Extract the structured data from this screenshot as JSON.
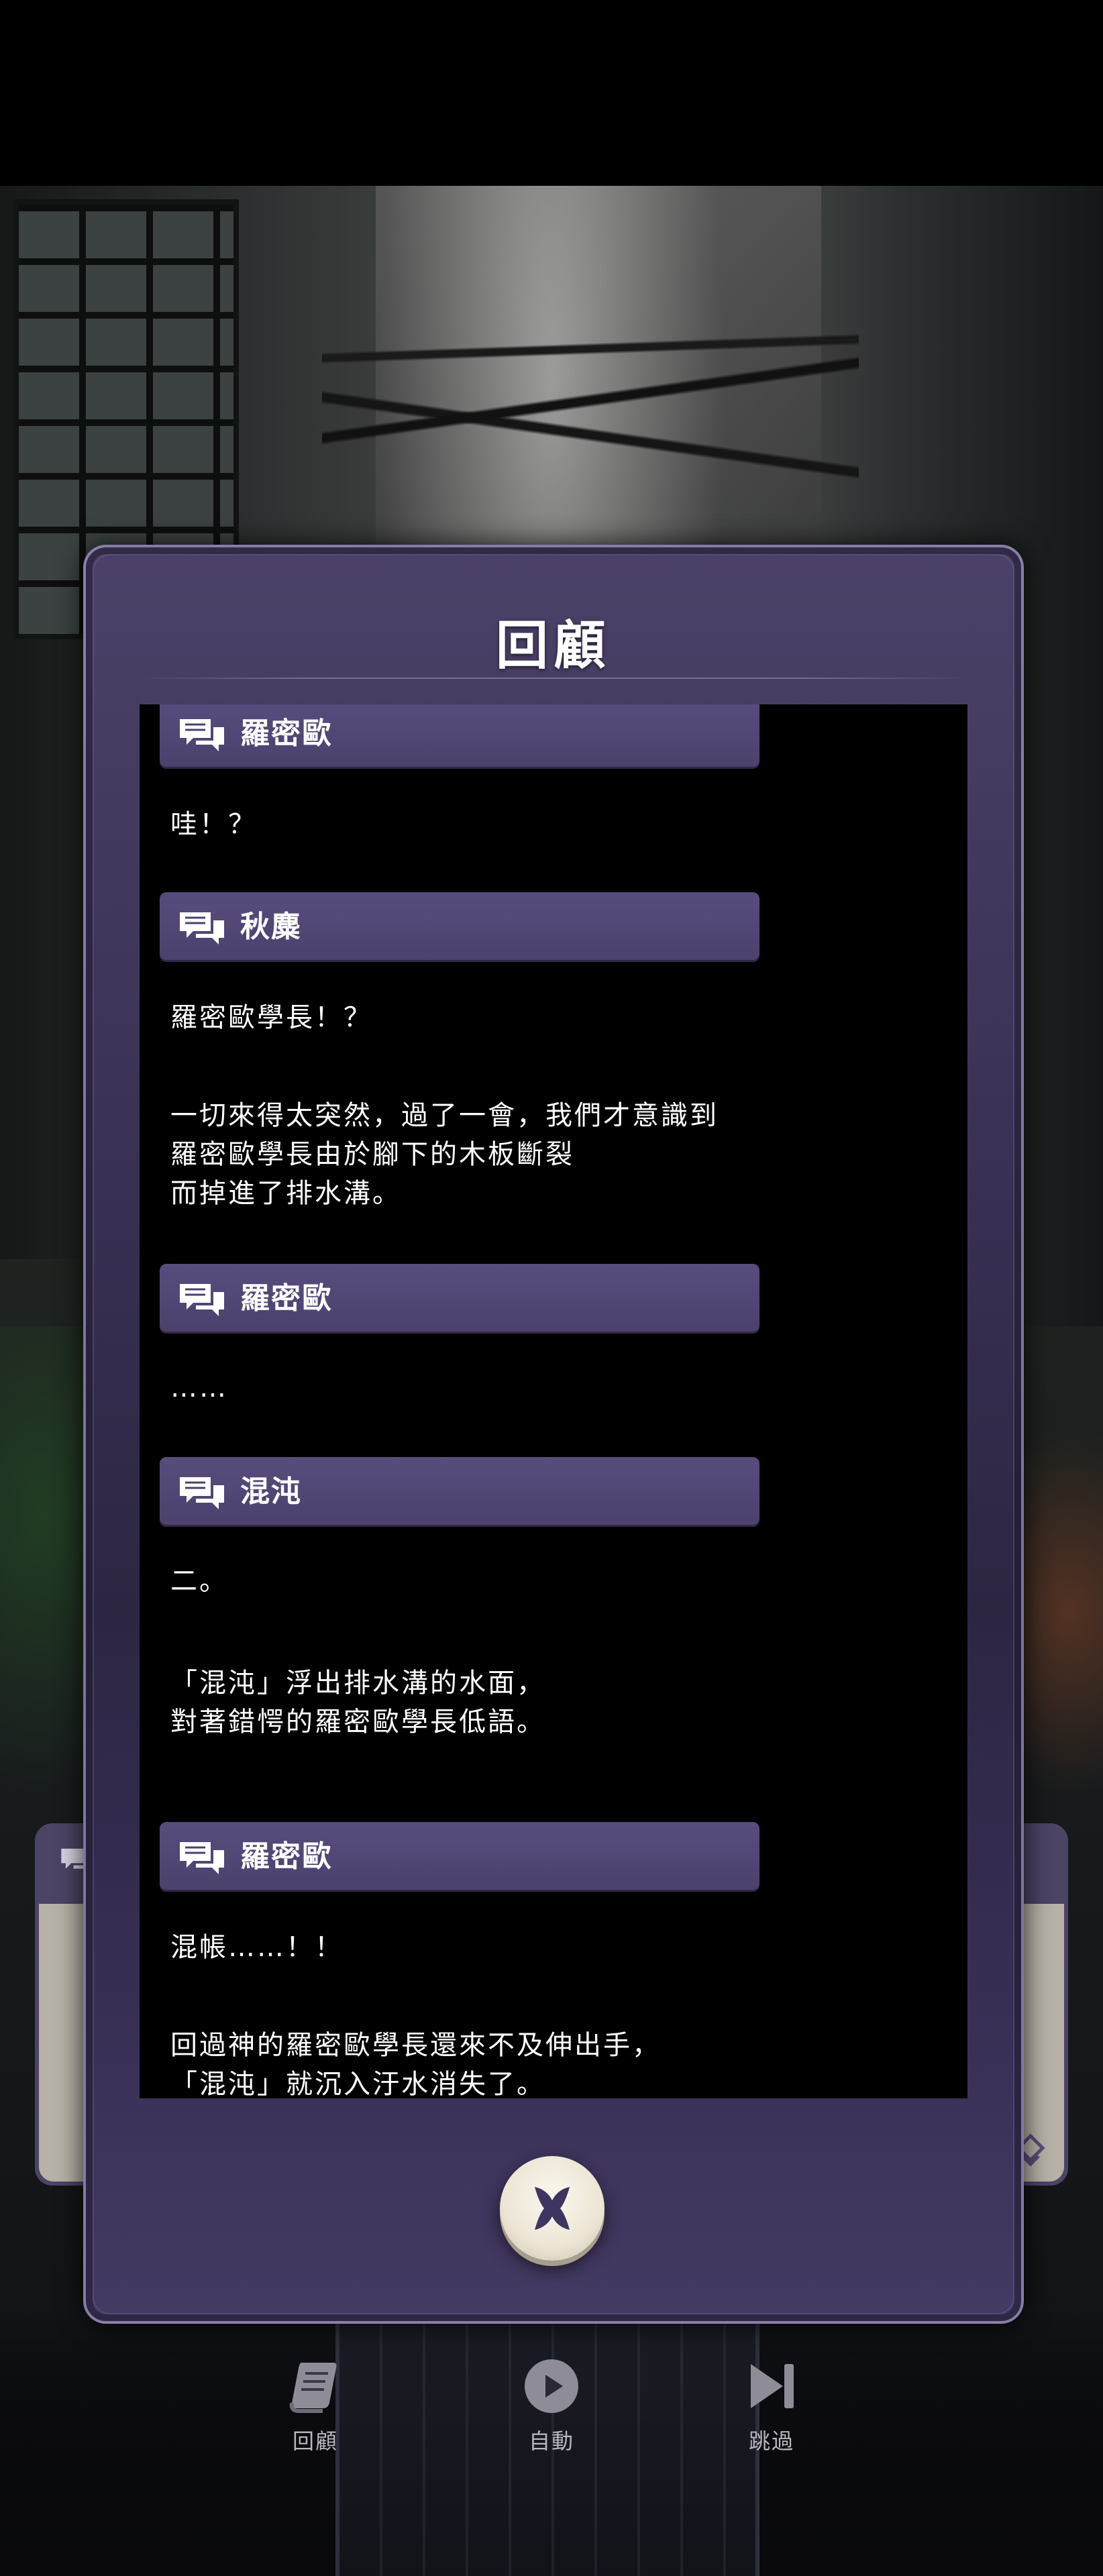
{
  "backlog": {
    "title": "回顧",
    "entries": [
      {
        "speaker": "羅密歐",
        "lines": [
          "哇！？"
        ]
      },
      {
        "speaker": "秋麋",
        "lines": [
          "羅密歐學長！？"
        ]
      },
      {
        "speaker": "",
        "lines": [
          "一切來得太突然，過了一會，我們才意識到",
          "羅密歐學長由於腳下的木板斷裂",
          "而掉進了排水溝。"
        ]
      },
      {
        "speaker": "羅密歐",
        "lines": [
          "……"
        ]
      },
      {
        "speaker": "混沌",
        "lines": [
          "二。"
        ]
      },
      {
        "speaker": "",
        "lines": [
          "「混沌」浮出排水溝的水面，",
          "對著錯愕的羅密歐學長低語。"
        ]
      },
      {
        "speaker": "羅密歐",
        "lines": [
          "混帳……！！"
        ]
      },
      {
        "speaker": "",
        "lines": [
          "回過神的羅密歐學長還來不及伸出手，",
          "「混沌」就沉入汙水消失了。"
        ]
      }
    ],
    "close_icon": "close-x-icon"
  },
  "bottom_menu": {
    "items": [
      {
        "label": "回顧",
        "icon": "scroll-icon"
      },
      {
        "label": "自動",
        "icon": "play-icon"
      },
      {
        "label": "跳過",
        "icon": "skip-icon"
      }
    ]
  },
  "colors": {
    "panel": "#3c3357",
    "speaker_bar": "#4b416c",
    "text": "#ffffff",
    "close_button": "#ece5d5",
    "close_x": "#3f3560"
  }
}
